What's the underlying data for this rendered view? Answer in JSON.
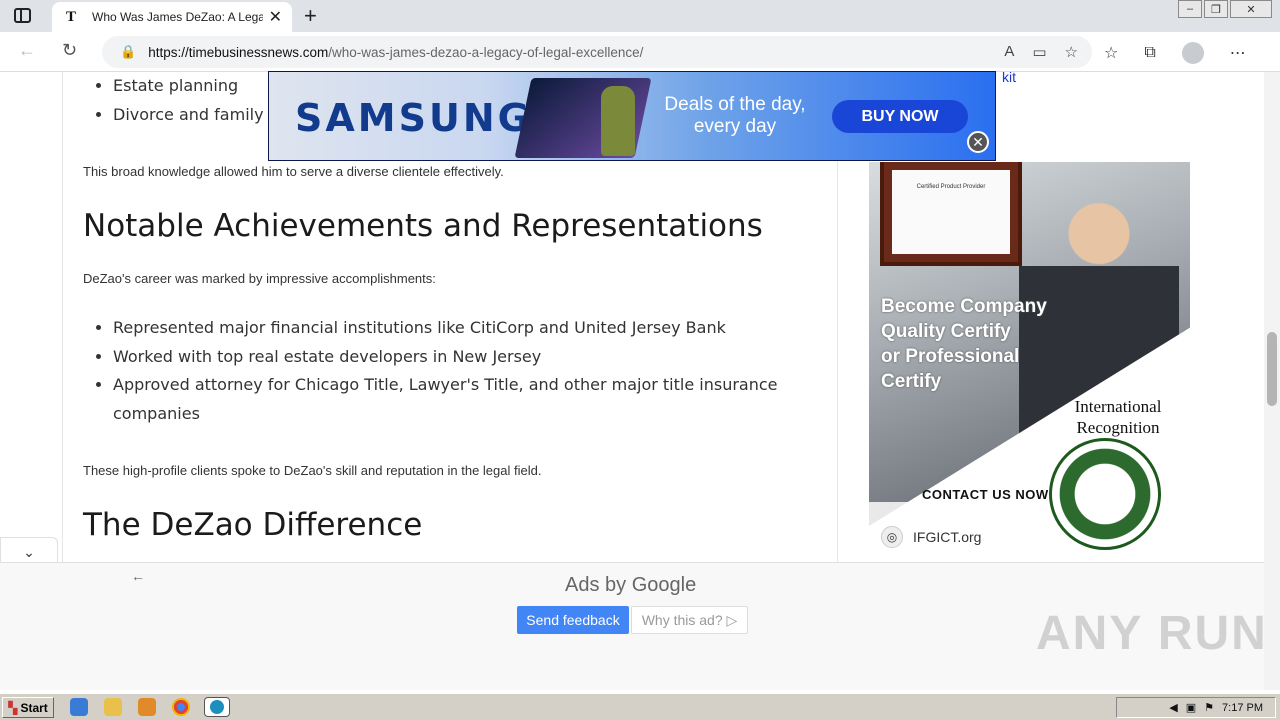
{
  "browser": {
    "tab_title": "Who Was James DeZao: A Legacy",
    "tab_favicon": "T",
    "url_host": "https://timebusinessnews.com",
    "url_path": "/who-was-james-dezao-a-legacy-of-legal-excellence/"
  },
  "article": {
    "list1": [
      "Estate planning",
      "Divorce and family la"
    ],
    "p1": "This broad knowledge allowed him to serve a diverse clientele effectively.",
    "h2_1": "Notable Achievements and Representations",
    "p2": "DeZao's career was marked by impressive accomplishments:",
    "list2": [
      "Represented major financial institutions like CitiCorp and United Jersey Bank",
      "Worked with top real estate developers in New Jersey",
      "Approved attorney for Chicago Title, Lawyer's Title, and other major title insurance",
      "companies"
    ],
    "p3": "These high-profile clients spoke to DeZao's skill and reputation in the legal field.",
    "h2_2": "The DeZao Difference"
  },
  "samsung_ad": {
    "logo": "SAMSUNG",
    "tagline_1": "Deals of the day,",
    "tagline_2": "every day",
    "buy": "BUY NOW"
  },
  "sidebar_ad": {
    "link_fragment": "kit",
    "headline_1": "Become Company",
    "headline_2": "Quality Certify",
    "headline_3": "or Professional",
    "headline_4": "Certify",
    "intl_1": "International",
    "intl_2": "Recognition",
    "seal_label": "IFGICT",
    "contact": "CONTACT US NOW",
    "site": "IFGICT.org"
  },
  "bottom_ad": {
    "ads_by": "Ads by",
    "google": "Google",
    "send_feedback": "Send feedback",
    "why_ad": "Why this ad? ▷"
  },
  "watermark": "ANY RUN",
  "taskbar": {
    "start": "Start",
    "clock": "7:17 PM"
  }
}
